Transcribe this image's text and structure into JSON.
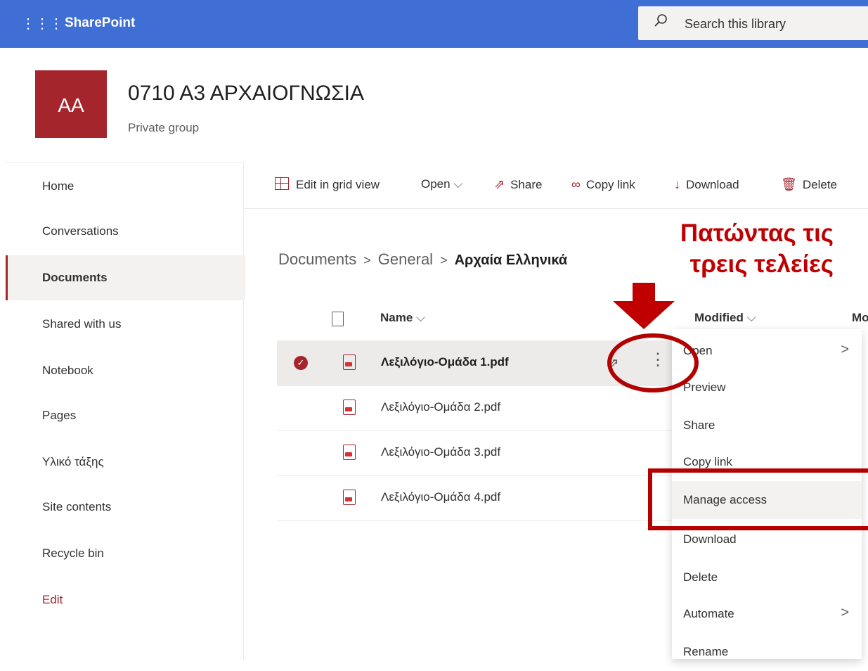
{
  "suite": {
    "app_name": "SharePoint",
    "search_placeholder": "Search this library",
    "waffle_icon": "waffle-icon"
  },
  "site": {
    "logo_initials": "AA",
    "title": "0710 Α3 ΑΡΧΑΙΟΓΝΩΣΙΑ",
    "subtitle": "Private group"
  },
  "nav": {
    "items": [
      {
        "label": "Home"
      },
      {
        "label": "Conversations"
      },
      {
        "label": "Documents"
      },
      {
        "label": "Shared with us"
      },
      {
        "label": "Notebook"
      },
      {
        "label": "Pages"
      },
      {
        "label": "Υλικό τάξης"
      },
      {
        "label": "Site contents"
      },
      {
        "label": "Recycle bin"
      },
      {
        "label": "Edit"
      }
    ],
    "selected": "Documents"
  },
  "commands": {
    "edit_grid": "Edit in grid view",
    "open": "Open",
    "share": "Share",
    "copy_link": "Copy link",
    "download": "Download",
    "delete": "Delete"
  },
  "breadcrumb": {
    "items": [
      "Documents",
      "General"
    ],
    "current": "Αρχαία Ελληνικά"
  },
  "columns": {
    "name": "Name",
    "modified": "Modified",
    "modified_by_cut": "Mo"
  },
  "files": [
    {
      "name": "Λεξιλόγιο-Ομάδα 1.pdf",
      "selected": true
    },
    {
      "name": "Λεξιλόγιο-Ομάδα 2.pdf",
      "selected": false
    },
    {
      "name": "Λεξιλόγιο-Ομάδα 3.pdf",
      "selected": false
    },
    {
      "name": "Λεξιλόγιο-Ομάδα 4.pdf",
      "selected": false
    }
  ],
  "context_menu": {
    "items": [
      "Open",
      "Preview",
      "Share",
      "Copy link",
      "Manage access",
      "Download",
      "Delete",
      "Automate",
      "Rename"
    ],
    "highlighted": "Manage access"
  },
  "annotation": {
    "line1": "Πατώντας τις",
    "line2": "τρεις τελείες",
    "color": "#c00000"
  }
}
